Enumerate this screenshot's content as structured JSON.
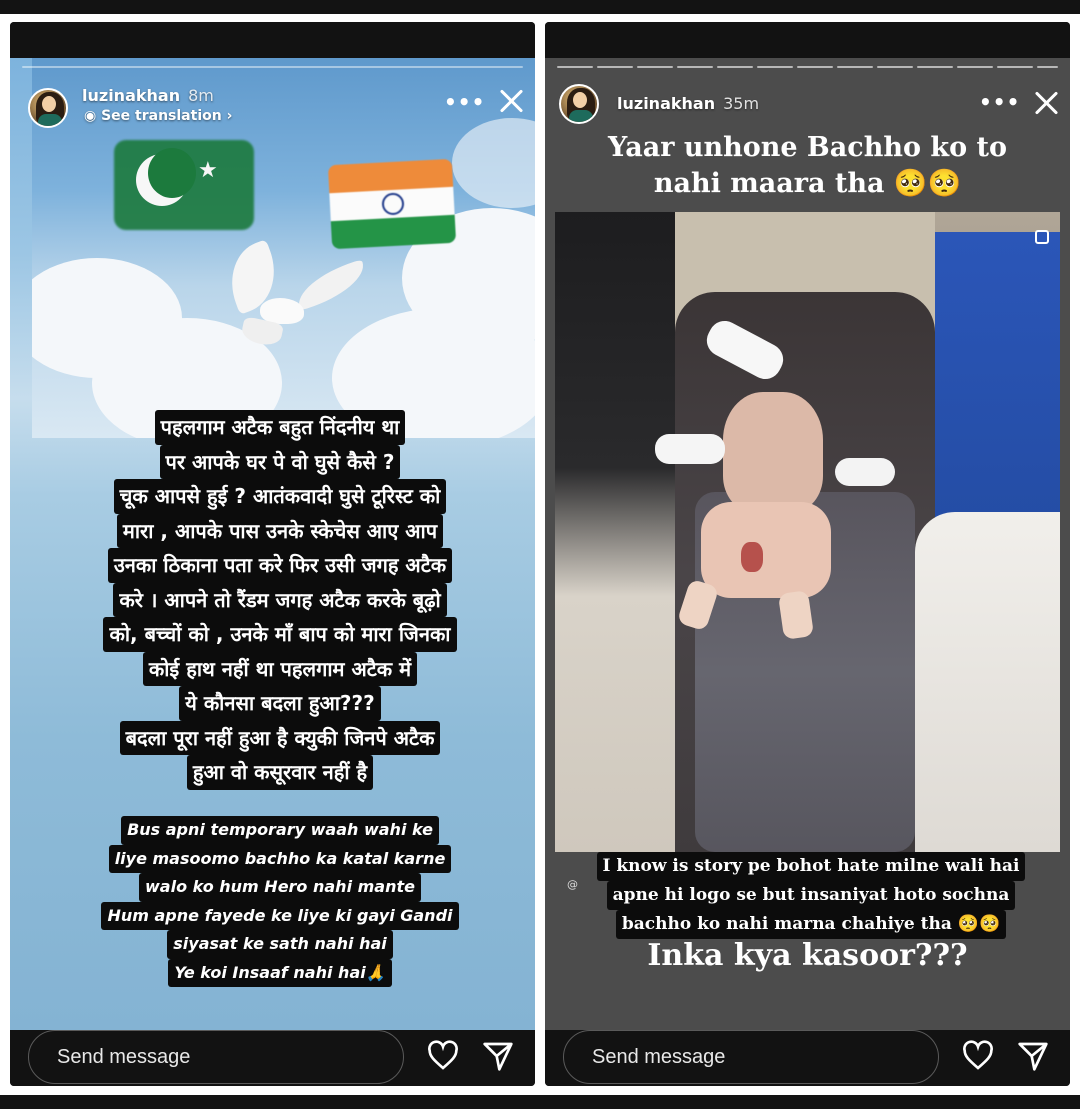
{
  "left_story": {
    "username": "luzinakhan",
    "time": "8m",
    "see_translation": "See translation",
    "more_icon": "•••",
    "hindi_lines": [
      "पहलगाम अटैक बहुत निंदनीय था",
      "पर आपके घर पे वो घुसे कैसे ?",
      "चूक आपसे हुई ? आतंकवादी घुसे टूरिस्ट को",
      "मारा , आपके पास उनके स्केचेस आए आप",
      "उनका ठिकाना पता करे फिर उसी जगह अटैक",
      "करे । आपने तो रैंडम जगह अटैक करके बूढ़ो",
      "को, बच्चों को , उनके माँ बाप को मारा जिनका",
      "कोई हाथ नहीं था पहलगाम अटैक में",
      "ये कौनसा बदला हुआ???",
      "बदला पूरा नहीं हुआ है क्युकी जिनपे अटैक",
      "हुआ वो कसूरवार नहीं है"
    ],
    "roman_lines": [
      "Bus apni temporary waah wahi ke",
      "liye masoomo bachho ka katal karne",
      "walo ko hum Hero nahi mante",
      "Hum apne fayede ke liye ki gayi Gandi",
      "siyasat ke sath nahi hai",
      "Ye koi Insaaf nahi hai🙏"
    ],
    "reply_placeholder": "Send message"
  },
  "right_story": {
    "username": "luzinakhan",
    "time": "35m",
    "more_icon": "•••",
    "header_lines": [
      "Yaar unhone Bachho ko to",
      "nahi maara tha 🥺🥺"
    ],
    "handle": "@",
    "caption_lines": [
      "I know is story pe bohot hate milne wali hai",
      "apne hi logo se but insaniyat hoto sochna",
      "bachho ko nahi marna chahiye tha 🥺🥺"
    ],
    "emphasis": "Inka kya kasoor???",
    "reply_placeholder": "Send message"
  },
  "icons": {
    "close": "close-icon",
    "heart": "heart-icon",
    "send": "send-icon",
    "more": "more-icon"
  }
}
